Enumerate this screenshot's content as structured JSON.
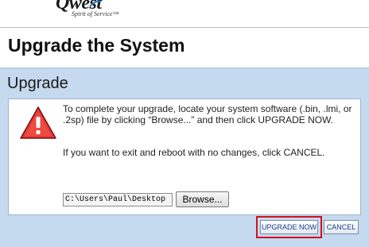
{
  "brand": {
    "name": "Qwest",
    "tagline": "Spirit of Service™"
  },
  "page": {
    "title": "Upgrade the System"
  },
  "panel": {
    "title": "Upgrade",
    "message_primary": "To complete your upgrade, locate your system software (.bin, .lmi, or .2sp) file by clicking “Browse...” and then click UPGRADE NOW.",
    "message_secondary": "If you want to exit and reboot with no changes, click CANCEL.",
    "file_path_value": "C:\\Users\\Paul\\Desktop",
    "browse_label": "Browse...",
    "upgrade_label": "UPGRADE NOW",
    "cancel_label": "CANCEL",
    "warning_icon": "warning-triangle-icon"
  },
  "colors": {
    "panel_background": "#c5d9ef",
    "highlight_border": "#d0121b",
    "warning_red": "#d32f2f",
    "button_text": "#1f3f8a"
  }
}
